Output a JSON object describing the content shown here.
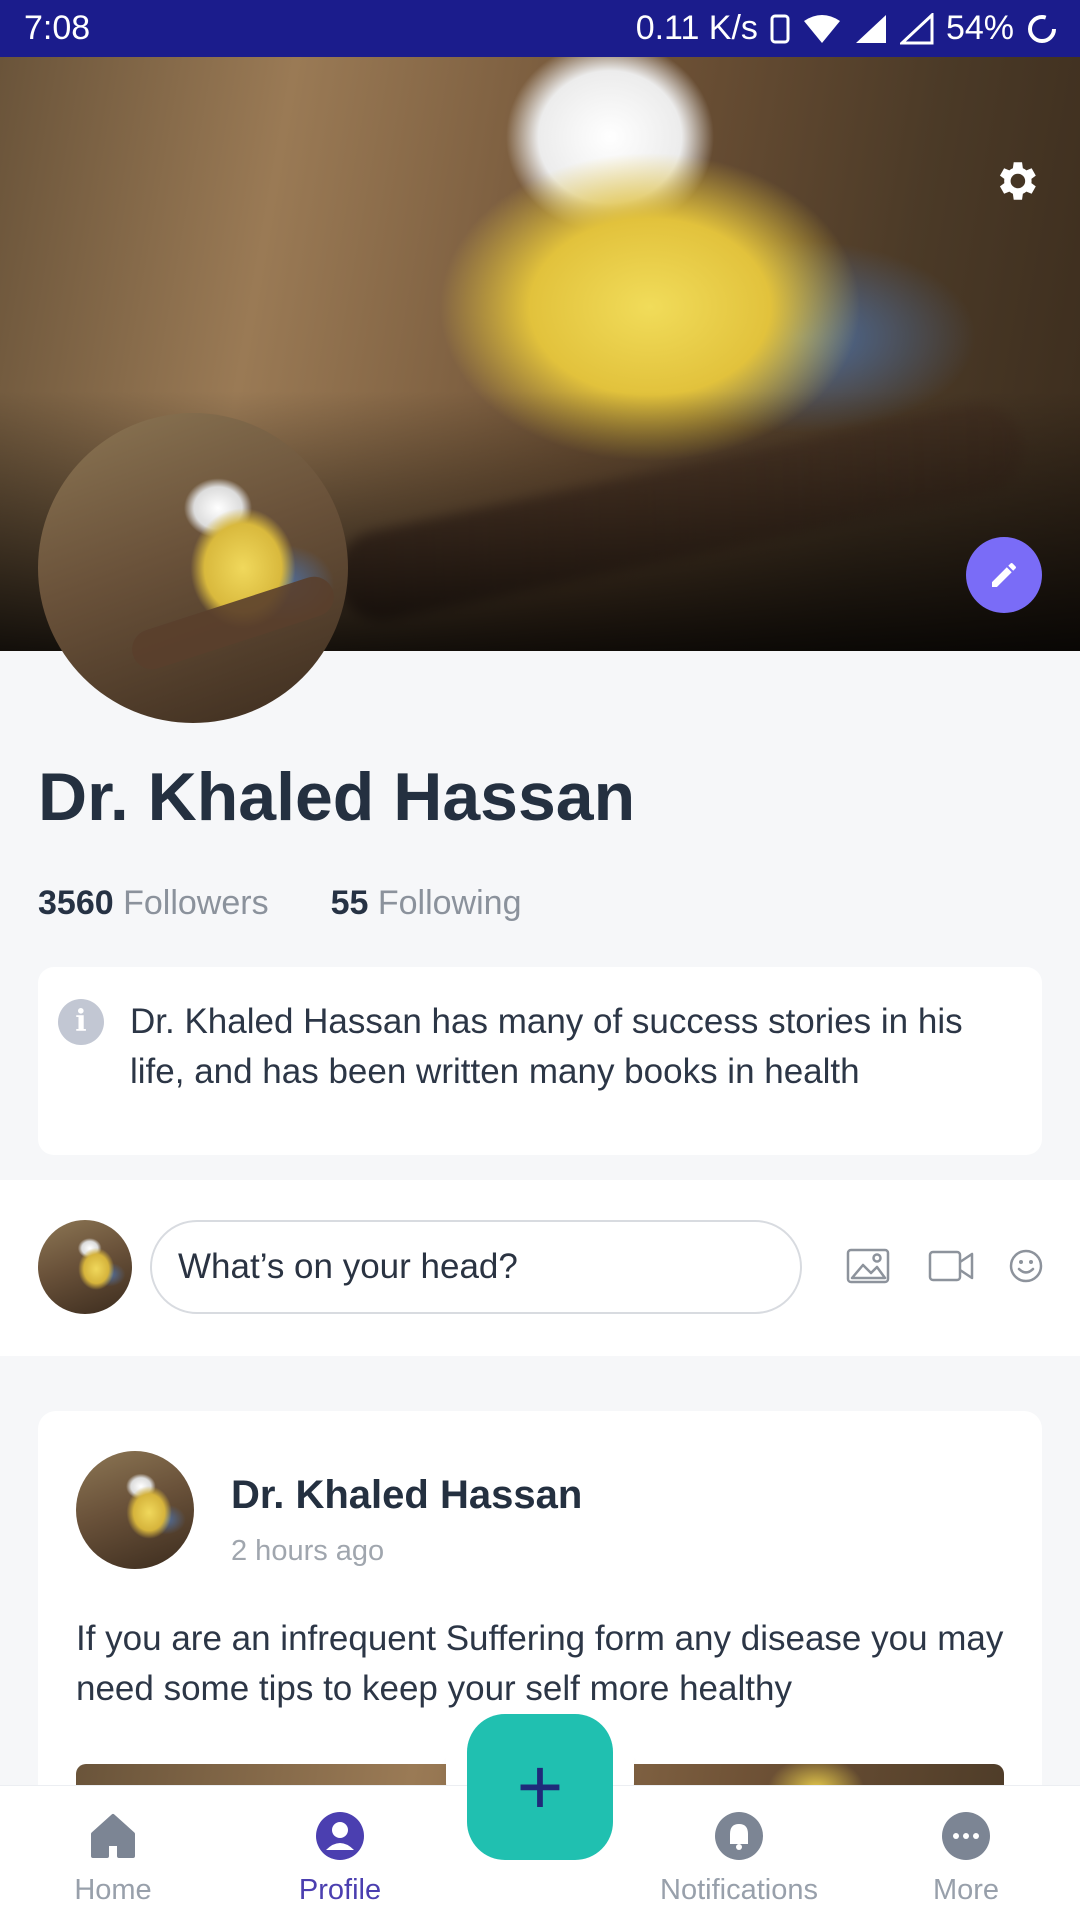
{
  "status_bar": {
    "time": "7:08",
    "net_speed": "0.11 K/s",
    "battery": "54%"
  },
  "profile": {
    "name": "Dr. Khaled Hassan",
    "followers_count": "3560",
    "followers_label": "Followers",
    "following_count": "55",
    "following_label": "Following",
    "bio": "Dr. Khaled Hassan has many of success stories in his life, and has been written many books in health"
  },
  "composer": {
    "placeholder": "What’s on your head?"
  },
  "post": {
    "author": "Dr. Khaled Hassan",
    "time": "2 hours ago",
    "text": "If you are an infrequent Suffering form any disease you may need some tips to keep your self more healthy"
  },
  "nav": {
    "home": "Home",
    "profile": "Profile",
    "notifications": "Notifications",
    "more": "More",
    "fab": "+"
  },
  "colors": {
    "accent": "#7a6cf7",
    "fab": "#20c0b0",
    "status_bar": "#1b1c8c",
    "active_nav": "#4b3fb0"
  }
}
